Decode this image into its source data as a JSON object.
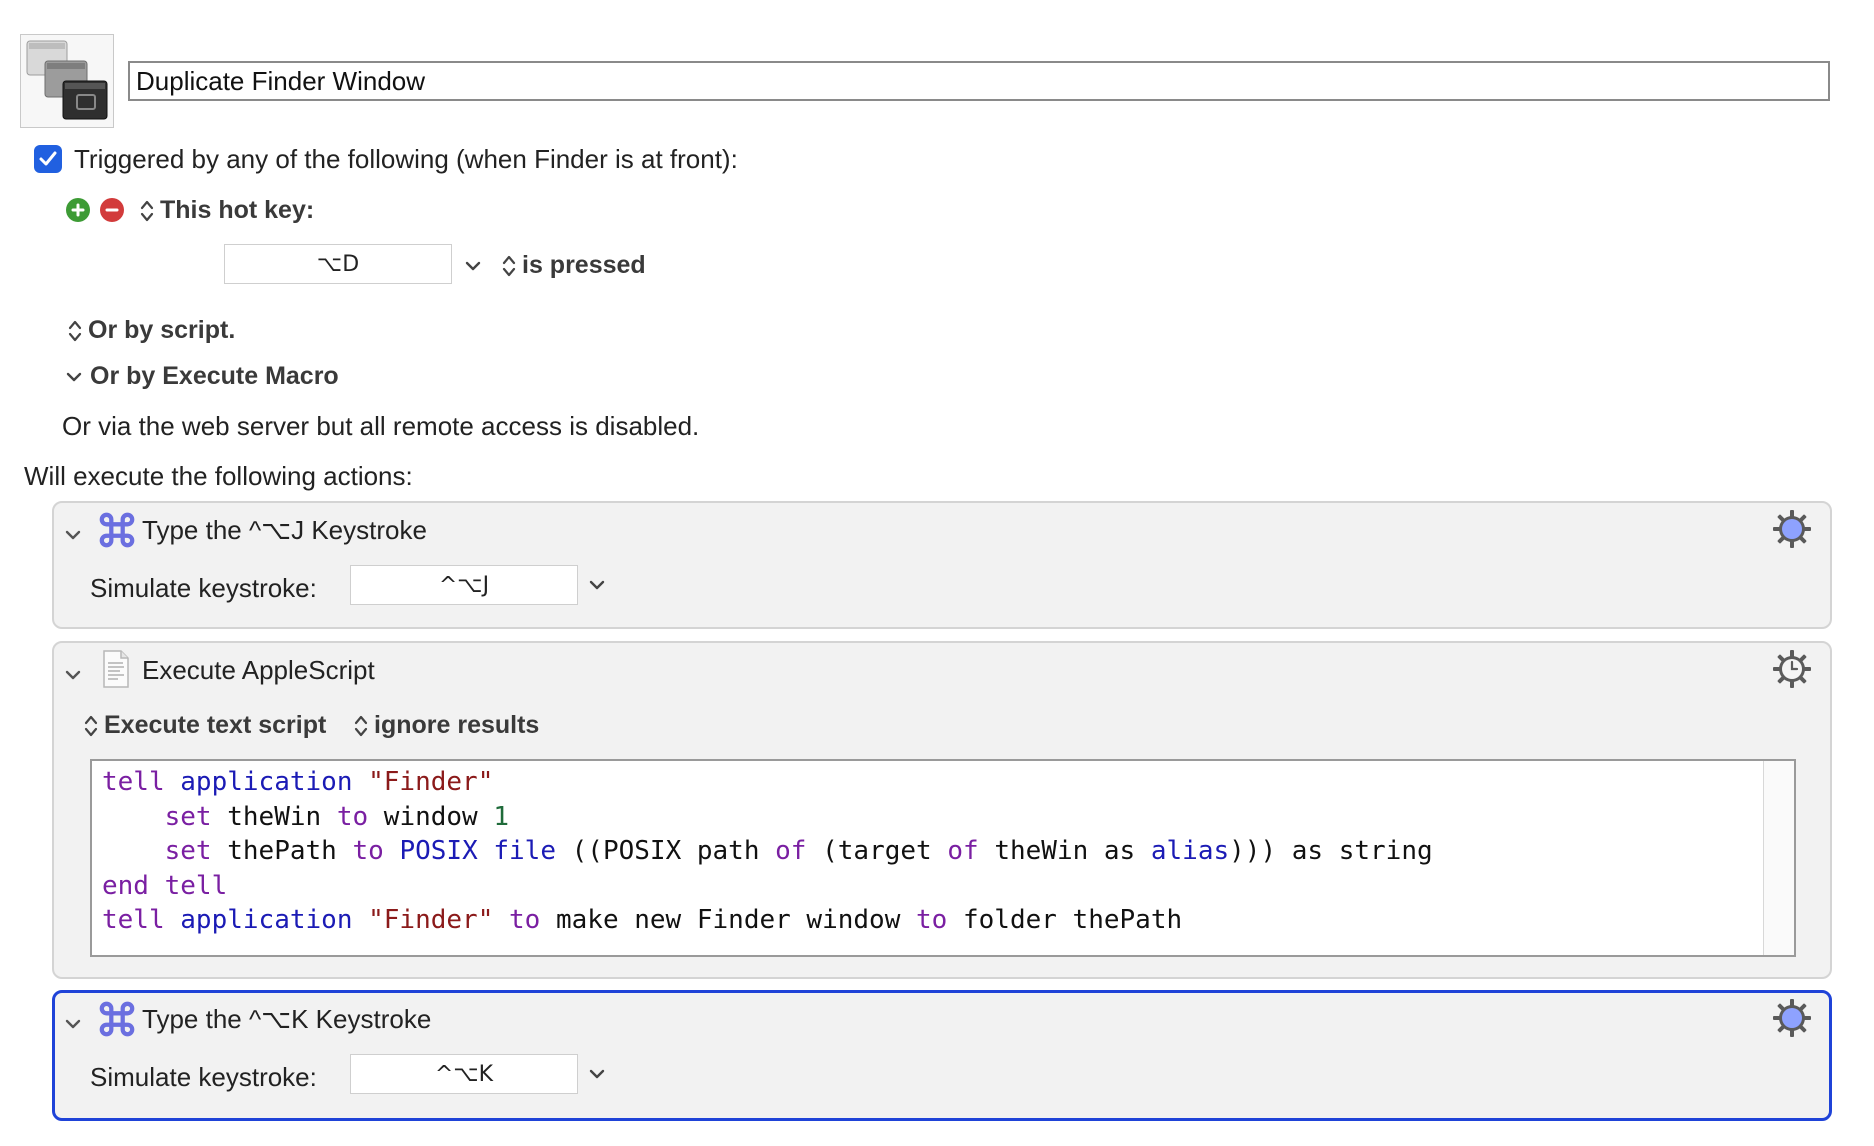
{
  "macro": {
    "name": "Duplicate Finder Window"
  },
  "trigger": {
    "enabled": true,
    "header": "Triggered by any of the following (when Finder is at front):",
    "hotkey_label": "This hot key:",
    "hotkey_value": "⌥D",
    "hotkey_condition": "is pressed",
    "by_script": "Or by script.",
    "by_execute_macro": "Or by Execute Macro",
    "web_server_note": "Or via the web server but all remote access is disabled."
  },
  "actions_header": "Will execute the following actions:",
  "actions": [
    {
      "title": "Type the ^⌥J Keystroke",
      "field_label": "Simulate keystroke:",
      "keystroke": "^⌥J",
      "icon": "command-icon"
    },
    {
      "title": "Execute AppleScript",
      "mode": "Execute text script",
      "results": "ignore results",
      "icon": "script-document-icon",
      "script_lines": [
        "tell application \"Finder\"",
        "    set theWin to window 1",
        "    set thePath to POSIX file ((POSIX path of (target of theWin as alias))) as string",
        "end tell",
        "tell application \"Finder\" to make new Finder window to folder thePath"
      ]
    },
    {
      "title": "Type the ^⌥K Keystroke",
      "field_label": "Simulate keystroke:",
      "keystroke": "^⌥K",
      "icon": "command-icon"
    }
  ],
  "colors": {
    "accent": "#2160e0",
    "selection_border": "#1f43d8",
    "panel_bg": "#f2f2f2",
    "add_button": "#3d9b35",
    "remove_button": "#d23b3b",
    "command_icon": "#6b6fe0"
  }
}
